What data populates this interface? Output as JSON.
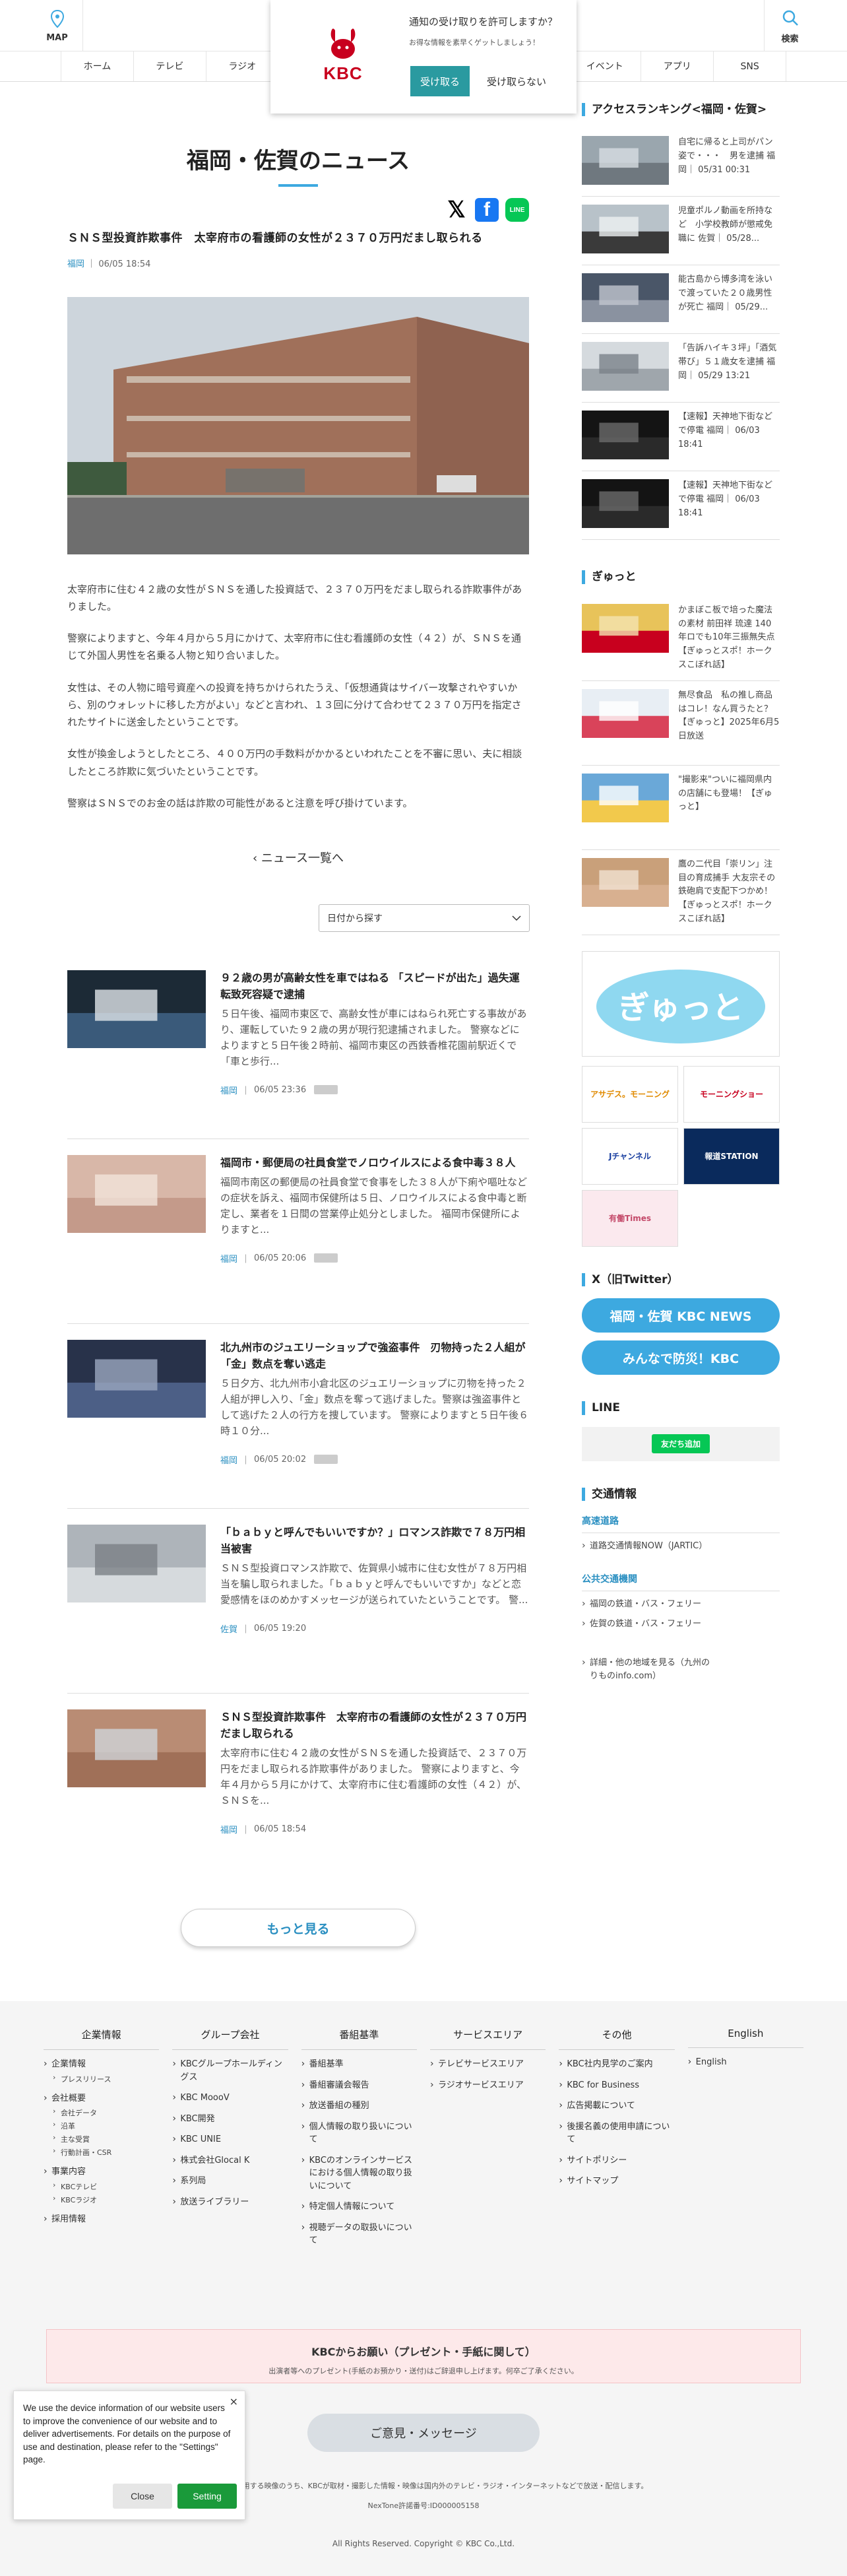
{
  "header": {
    "map_label": "MAP",
    "search_label": "検索"
  },
  "gnav": {
    "items": [
      "ホーム",
      "テレビ",
      "ラジオ",
      "",
      "",
      "",
      "",
      "イベント",
      "アプリ",
      "SNS"
    ]
  },
  "notification": {
    "logo_text": "KBC",
    "title": "通知の受け取りを許可しますか？",
    "subtitle": "お得な情報を素早くゲットしましょう！",
    "accept": "受け取る",
    "decline": "受け取らない"
  },
  "page": {
    "title": "福岡・佐賀のニュース"
  },
  "share": {
    "x": "𝕏",
    "facebook": "f",
    "line": "LINE"
  },
  "article": {
    "title": "ＳＮＳ型投資詐欺事件　太宰府市の看護師の女性が２３７０万円だまし取られる",
    "area": "福岡",
    "date": "06/05 18:54",
    "paragraphs": [
      "太宰府市に住む４２歳の女性がＳＮＳを通した投資話で、２３７０万円をだまし取られる詐欺事件がありました。",
      "警察によりますと、今年４月から５月にかけて、太宰府市に住む看護師の女性（４２）が、ＳＮＳを通じて外国人男性を名乗る人物と知り合いました。",
      "女性は、その人物に暗号資産への投資を持ちかけられたうえ、「仮想通貨はサイバー攻撃されやすいから、別のウォレットに移した方がよい」などと言われ、１３回に分けて合わせて２３７０万円を指定されたサイトに送金したということです。",
      "女性が換金しようとしたところ、４００万円の手数料がかかるといわれたことを不審に思い、夫に相談したところ詐欺に気づいたということです。",
      "警察はＳＮＳでのお金の話は詐欺の可能性があると注意を呼び掛けています。"
    ]
  },
  "back_link": "ニュース一覧へ",
  "date_filter": "日付から探す",
  "news": [
    {
      "title": "９２歳の男が高齢女性を車ではねる 「スピードが出た」過失運転致死容疑で逮捕",
      "desc": "５日午後、福岡市東区で、高齢女性が車にはねられ死亡する事故があり、運転していた９２歳の男が現行犯逮捕されました。 警察などによりますと５日午後２時前、福岡市東区の西鉄香椎花園前駅近くで「車と歩行...",
      "area": "福岡",
      "date": "06/05 23:36"
    },
    {
      "title": "福岡市・郵便局の社員食堂でノロウイルスによる食中毒３８人",
      "desc": "福岡市南区の郵便局の社員食堂で食事をした３８人が下痢や嘔吐などの症状を訴え、福岡市保健所は５日、ノロウイルスによる食中毒と断定し、業者を１日間の営業停止処分としました。 福岡市保健所によりますと...",
      "area": "福岡",
      "date": "06/05 20:06"
    },
    {
      "title": "北九州市のジュエリーショップで強盗事件　刃物持った２人組が「金」数点を奪い逃走",
      "desc": "５日夕方、北九州市小倉北区のジュエリーショップに刃物を持った２人組が押し入り、「金」数点を奪って逃げました。警察は強盗事件として逃げた２人の行方を捜しています。 警察によりますと５日午後６時１０分...",
      "area": "福岡",
      "date": "06/05 20:02"
    },
    {
      "title": "「ｂａｂｙと呼んでもいいですか？」ロマンス詐欺で７８万円相当被害",
      "desc": "ＳＮＳ型投資ロマンス詐欺で、佐賀県小城市に住む女性が７８万円相当を騙し取られました。「ｂａｂｙと呼んでもいいですか」などと恋愛感情をほのめかすメッセージが送られていたということです。 警...",
      "area": "佐賀",
      "date": "06/05 19:20"
    },
    {
      "title": "ＳＮＳ型投資詐欺事件　太宰府市の看護師の女性が２３７０万円だまし取られる",
      "desc": "太宰府市に住む４２歳の女性がＳＮＳを通した投資話で、２３７０万円をだまし取られる詐欺事件がありました。 警察によりますと、今年４月から５月にかけて、太宰府市に住む看護師の女性（４２）が、ＳＮＳを...",
      "area": "福岡",
      "date": "06/05 18:54"
    }
  ],
  "more_button": "もっと見る",
  "ranking": {
    "heading": "アクセスランキング<福岡・佐賀>",
    "items": [
      "自宅に帰ると上司がパン姿で・・・　男を逮捕 福岡｜ 05/31 00:31",
      "児童ポルノ動画を所持など　小学校教師が懲戒免職に 佐賀｜ 05/28...",
      "能古島から博多湾を泳いで渡っていた２０歳男性が死亡 福岡｜ 05/29...",
      "「告訴ハイキ３坪」「酒気帯び」５１歳女を逮捕 福岡｜ 05/29 13:21",
      "【速報】天神地下街などで停電 福岡｜ 06/03 18:41",
      "【速報】天神地下街などで停電 福岡｜ 06/03 18:41"
    ]
  },
  "gyutto": {
    "heading": "ぎゅっと",
    "items": [
      "かまぼこ板で培った魔法の素材 前田祥 琉達 140年ロでも10年三振無失点【ぎゅっとスポ！ホークスこぼれ話】",
      "無尽食品　私の推し商品はコレ！なん買うたと？【ぎゅっと】2025年6月5日放送",
      "\"撮影来\"ついに福岡県内の店舗にも登場！【ぎゅっと】",
      "鷹の二代目「崇リン」注目の育成捕手 大友宗その鉄砲肩で支配下つかめ！【ぎゅっとスポ！ホークスこぼれ話】"
    ],
    "banner": "ぎゅっと",
    "small_banners": [
      "アサデス。モーニング",
      "モーニングショー",
      "Jチャンネル",
      "報道STATION",
      "有働Times"
    ]
  },
  "x_section": {
    "heading": "X（旧Twitter）",
    "buttons": [
      "福岡・佐賀 KBC NEWS",
      "みんなで防災！KBC"
    ]
  },
  "line_section": {
    "heading": "LINE",
    "add_button": "友だち追加"
  },
  "traffic": {
    "heading": "交通情報",
    "road_title": "高速道路",
    "road_links": [
      "道路交通情報NOW（JARTIC）"
    ],
    "public_title": "公共交通機関",
    "public_links": [
      "福岡の鉄道・バス・フェリー",
      "佐賀の鉄道・バス・フェリー"
    ],
    "more_link": "詳細・他の地域を見る（九州のりものinfo.com）"
  },
  "footer": {
    "columns": [
      {
        "title": "企業情報",
        "links": [
          {
            "label": "企業情報",
            "subs": [
              "プレスリリース"
            ]
          },
          {
            "label": "会社概要",
            "subs": [
              "会社データ",
              "沿革",
              "主な受賞",
              "行動計画・CSR"
            ]
          },
          {
            "label": "事業内容",
            "subs": [
              "KBCテレビ",
              "KBCラジオ"
            ]
          },
          {
            "label": "採用情報",
            "subs": []
          }
        ]
      },
      {
        "title": "グループ会社",
        "links": [
          {
            "label": "KBCグループホールディングス",
            "subs": []
          },
          {
            "label": "KBC MoooV",
            "subs": []
          },
          {
            "label": "KBC開発",
            "subs": []
          },
          {
            "label": "KBC UNIE",
            "subs": []
          },
          {
            "label": "株式会社Glocal K",
            "subs": []
          },
          {
            "label": "系列局",
            "subs": []
          },
          {
            "label": "放送ライブラリー",
            "subs": []
          }
        ]
      },
      {
        "title": "番組基準",
        "links": [
          {
            "label": "番組基準",
            "subs": []
          },
          {
            "label": "番組審議会報告",
            "subs": []
          },
          {
            "label": "放送番組の種別",
            "subs": []
          },
          {
            "label": "個人情報の取り扱いについて",
            "subs": []
          },
          {
            "label": "KBCのオンラインサービスにおける個人情報の取り扱いについて",
            "subs": []
          },
          {
            "label": "特定個人情報について",
            "subs": []
          },
          {
            "label": "視聴データの取扱いについて",
            "subs": []
          }
        ]
      },
      {
        "title": "サービスエリア",
        "links": [
          {
            "label": "テレビサービスエリア",
            "subs": []
          },
          {
            "label": "ラジオサービスエリア",
            "subs": []
          }
        ]
      },
      {
        "title": "その他",
        "links": [
          {
            "label": "KBC社内見学のご案内",
            "subs": []
          },
          {
            "label": "KBC for Business",
            "subs": []
          },
          {
            "label": "広告掲載について",
            "subs": []
          },
          {
            "label": "後援名義の使用申請について",
            "subs": []
          },
          {
            "label": "サイトポリシー",
            "subs": []
          },
          {
            "label": "サイトマップ",
            "subs": []
          }
        ]
      },
      {
        "title": "English",
        "links": [
          {
            "label": "English",
            "subs": []
          }
        ]
      }
    ],
    "present_title": "KBCからお願い（プレゼント・手紙に関して）",
    "present_sub": "出演者等へのプレゼント(手紙のお預かり・送付)はご辞退申し上げます。何卒ご了承ください。",
    "opinion_button": "ご意見・メッセージ",
    "note": "当サイトで使用する映像のうち、KBCが取材・撮影した情報・映像は国内外のテレビ・ラジオ・インターネットなどで放送・配信します。",
    "license": "NexTone許諾番号:ID000005158",
    "copyright": "All Rights Reserved. Copyright © KBC Co.,Ltd."
  },
  "consent": {
    "text": "We use the device information of our website users to improve the convenience of our website and to deliver advertisements. For details on the purpose of use and destination, please refer to the \"Settings\" page.",
    "close_x": "×",
    "close": "Close",
    "setting": "Setting"
  }
}
